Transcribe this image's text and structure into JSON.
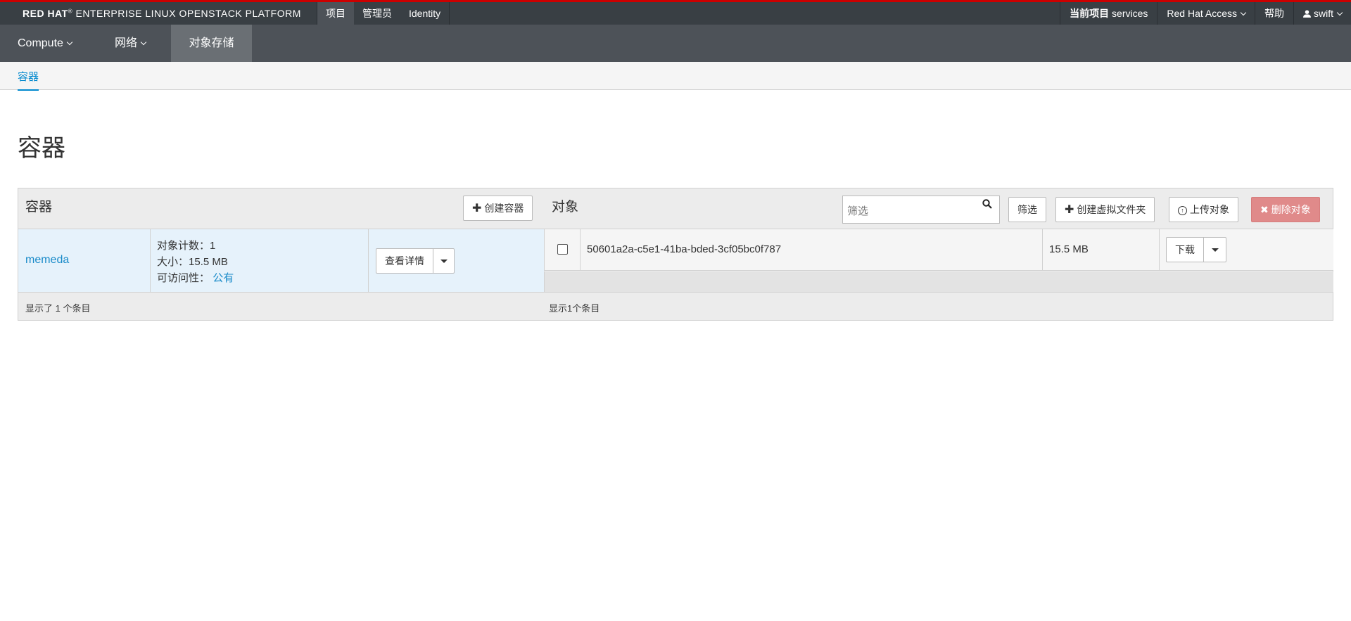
{
  "brand": {
    "bold": "RED HAT",
    "mark": "®",
    "rest": "ENTERPRISE LINUX OPENSTACK PLATFORM"
  },
  "top_nav": {
    "left_items": [
      {
        "label": "项目",
        "active": true
      },
      {
        "label": "管理员",
        "active": false
      },
      {
        "label": "Identity",
        "active": false
      }
    ],
    "current_project_label": "当前项目",
    "current_project_value": "services",
    "red_hat_access": "Red Hat Access",
    "help": "帮助",
    "user": "swift"
  },
  "sub_nav": {
    "items": [
      {
        "label": "Compute",
        "dropdown": true,
        "active": false
      },
      {
        "label": "网络",
        "dropdown": true,
        "active": false
      },
      {
        "label": "对象存储",
        "dropdown": false,
        "active": true
      }
    ]
  },
  "tabs": {
    "active": "容器"
  },
  "page_title": "容器",
  "containers_panel": {
    "title": "容器",
    "create_button": "创建容器",
    "rows": [
      {
        "name": "memeda",
        "object_count_label": "对象计数：",
        "object_count": "1",
        "size_label": "大小：",
        "size": "15.5 MB",
        "access_label": "可访问性：",
        "access": "公有",
        "details_button": "查看详情"
      }
    ],
    "footer": "显示了 1 个条目"
  },
  "objects_panel": {
    "title": "对象",
    "filter_placeholder": "筛选",
    "filter_button": "筛选",
    "create_folder_button": "创建虚拟文件夹",
    "upload_button": "上传对象",
    "delete_button": "删除对象",
    "rows": [
      {
        "name": "50601a2a-c5e1-41ba-bded-3cf05bc0f787",
        "size": "15.5 MB",
        "action": "下载"
      }
    ],
    "footer": "显示1个条目"
  },
  "colors": {
    "accent": "#0088ce",
    "topbar": "#393f44",
    "subnav": "#4d5258",
    "brand_red": "#cc0000",
    "danger": "#e08a8a",
    "link": "#1a8bc9"
  },
  "icons": {
    "search": "search-icon",
    "plus": "plus-icon",
    "upload": "upload-circle-icon",
    "delete": "x-icon",
    "user": "user-icon",
    "caret": "caret-down-icon"
  }
}
